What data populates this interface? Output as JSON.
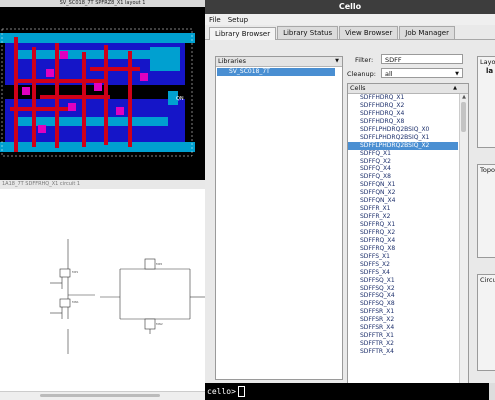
{
  "layout_window": {
    "title": "SV_SC018_7T SPFRZ8_X1 layout 1",
    "pin_label": "QN"
  },
  "schematic_window": {
    "title": "1A18_7T SDFFRHQ_X1 circuit 1"
  },
  "app": {
    "title": "Cello"
  },
  "menu": [
    "File",
    "Setup"
  ],
  "tabs": [
    "Library Browser",
    "Library Status",
    "View Browser",
    "Job Manager"
  ],
  "libraries": {
    "header": "Libraries",
    "items": [
      "SV_SC018_7T"
    ],
    "selected": "SV_SC018_7T"
  },
  "filter": {
    "label": "Filter:",
    "value": "SDFF"
  },
  "cleanup": {
    "label": "Cleanup:",
    "value": "all"
  },
  "cells": {
    "header": "Cells",
    "selected": "SDFFLPHDRQ2BSIQ_X2",
    "items": [
      "SDFFHDRQ_X1",
      "SDFFHDRQ_X2",
      "SDFFHDRQ_X4",
      "SDFFHDRQ_X8",
      "SDFFLPHDRQ2BSIQ_X0",
      "SDFFLPHDRQ2BSIQ_X1",
      "SDFFLPHDRQ2BSIQ_X2",
      "SDFFQ_X1",
      "SDFFQ_X2",
      "SDFFQ_X4",
      "SDFFQ_X8",
      "SDFFQN_X1",
      "SDFFQN_X2",
      "SDFFQN_X4",
      "SDFFR_X1",
      "SDFFR_X2",
      "SDFFRQ_X1",
      "SDFFRQ_X2",
      "SDFFRQ_X4",
      "SDFFRQ_X8",
      "SDFFS_X1",
      "SDFFS_X2",
      "SDFFS_X4",
      "SDFFSQ_X1",
      "SDFFSQ_X2",
      "SDFFSQ_X4",
      "SDFFSQ_X8",
      "SDFFSR_X1",
      "SDFFSR_X2",
      "SDFFSR_X4",
      "SDFFTR_X1",
      "SDFFTR_X2",
      "SDFFTR_X4"
    ]
  },
  "panels": {
    "layout": "Layo",
    "layout_sub": "la",
    "topology": "Topo",
    "circuit": "Circu"
  },
  "console": {
    "prompt": "cello>"
  },
  "colors": {
    "selection": "#4a8fd2",
    "layout_bg": "#000000",
    "layout_blue": "#1515c8",
    "layout_cyan": "#00a0d0",
    "layout_red": "#d00018",
    "layout_magenta": "#e000c0"
  }
}
